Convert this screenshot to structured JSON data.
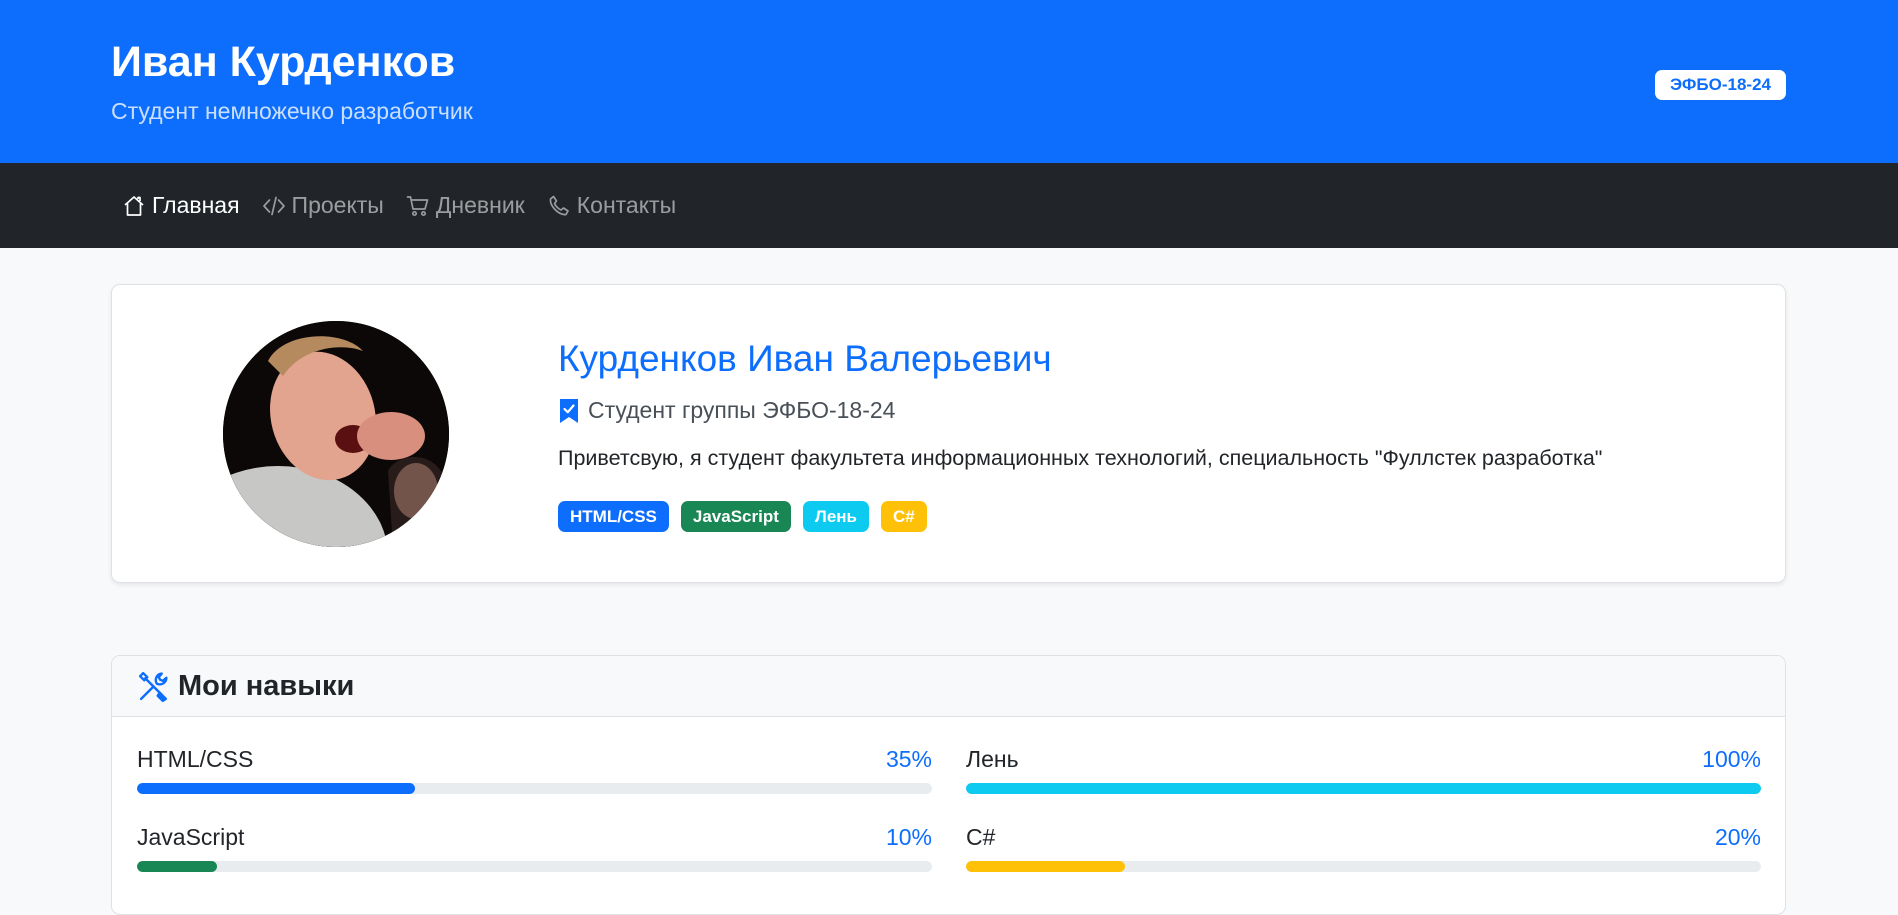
{
  "header": {
    "title": "Иван Курденков",
    "subtitle": "Студент немножечко разработчик",
    "badge": "ЭФБО-18-24",
    "background_color": "#0d6efd"
  },
  "nav": {
    "items": [
      {
        "label": "Главная",
        "icon": "house-icon",
        "active": true
      },
      {
        "label": "Проекты",
        "icon": "code-icon",
        "active": false
      },
      {
        "label": "Дневник",
        "icon": "cart-icon",
        "active": false
      },
      {
        "label": "Контакты",
        "icon": "phone-icon",
        "active": false
      }
    ]
  },
  "profile": {
    "name": "Курденков Иван Валерьевич",
    "group": "Студент группы ЭФБО-18-24",
    "group_icon": "bookmark-check-icon",
    "description": "Приветсвую, я студент факультета информационных технологий, специальность \"Фуллстек разработка\"",
    "tags": [
      {
        "label": "HTML/CSS",
        "color": "#0d6efd"
      },
      {
        "label": "JavaScript",
        "color": "#198754"
      },
      {
        "label": "Лень",
        "color": "#0dcaf0"
      },
      {
        "label": "C#",
        "color": "#ffc107"
      }
    ]
  },
  "skills": {
    "title": "Мои навыки",
    "title_icon": "tools-icon",
    "items": [
      {
        "name": "HTML/CSS",
        "percent_label": "35%",
        "value": 35,
        "color": "#0d6efd"
      },
      {
        "name": "Лень",
        "percent_label": "100%",
        "value": 100,
        "color": "#0dcaf0"
      },
      {
        "name": "JavaScript",
        "percent_label": "10%",
        "value": 10,
        "color": "#198754"
      },
      {
        "name": "C#",
        "percent_label": "20%",
        "value": 20,
        "color": "#ffc107"
      }
    ]
  }
}
